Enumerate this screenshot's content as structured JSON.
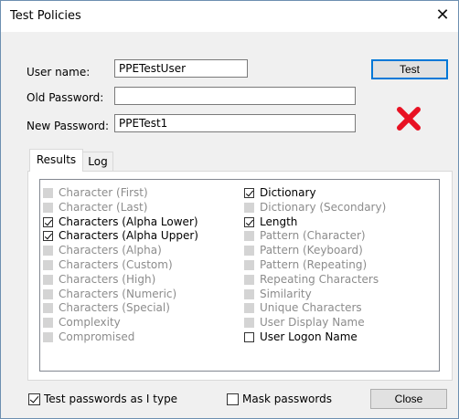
{
  "window": {
    "title": "Test Policies"
  },
  "form": {
    "username_label": "User name:",
    "username_value": "PPETestUser",
    "old_password_label": "Old Password:",
    "old_password_value": "",
    "new_password_label": "New Password:",
    "new_password_value": "PPETest1"
  },
  "buttons": {
    "test": "Test",
    "close": "Close"
  },
  "tabs": [
    {
      "label": "Results",
      "active": true
    },
    {
      "label": "Log",
      "active": false
    }
  ],
  "results": {
    "left": [
      {
        "label": "Character (First)",
        "checked": false,
        "enabled": false
      },
      {
        "label": "Character (Last)",
        "checked": false,
        "enabled": false
      },
      {
        "label": "Characters (Alpha Lower)",
        "checked": true,
        "enabled": true
      },
      {
        "label": "Characters (Alpha Upper)",
        "checked": true,
        "enabled": true
      },
      {
        "label": "Characters (Alpha)",
        "checked": false,
        "enabled": false
      },
      {
        "label": "Characters (Custom)",
        "checked": false,
        "enabled": false
      },
      {
        "label": "Characters (High)",
        "checked": false,
        "enabled": false
      },
      {
        "label": "Characters (Numeric)",
        "checked": false,
        "enabled": false
      },
      {
        "label": "Characters (Special)",
        "checked": false,
        "enabled": false
      },
      {
        "label": "Complexity",
        "checked": false,
        "enabled": false
      },
      {
        "label": "Compromised",
        "checked": false,
        "enabled": false
      }
    ],
    "right": [
      {
        "label": "Dictionary",
        "checked": true,
        "enabled": true
      },
      {
        "label": "Dictionary (Secondary)",
        "checked": false,
        "enabled": false
      },
      {
        "label": "Length",
        "checked": true,
        "enabled": true
      },
      {
        "label": "Pattern (Character)",
        "checked": false,
        "enabled": false
      },
      {
        "label": "Pattern (Keyboard)",
        "checked": false,
        "enabled": false
      },
      {
        "label": "Pattern (Repeating)",
        "checked": false,
        "enabled": false
      },
      {
        "label": "Repeating Characters",
        "checked": false,
        "enabled": false
      },
      {
        "label": "Similarity",
        "checked": false,
        "enabled": false
      },
      {
        "label": "Unique Characters",
        "checked": false,
        "enabled": false
      },
      {
        "label": "User Display Name",
        "checked": false,
        "enabled": false
      },
      {
        "label": "User Logon Name",
        "checked": false,
        "enabled": true
      }
    ]
  },
  "options": {
    "test_as_type_label": "Test passwords as I type",
    "test_as_type_checked": true,
    "mask_passwords_label": "Mask passwords",
    "mask_passwords_checked": false
  },
  "status": {
    "result_icon": "red-x-fail-icon",
    "result_color": "#e81123"
  }
}
